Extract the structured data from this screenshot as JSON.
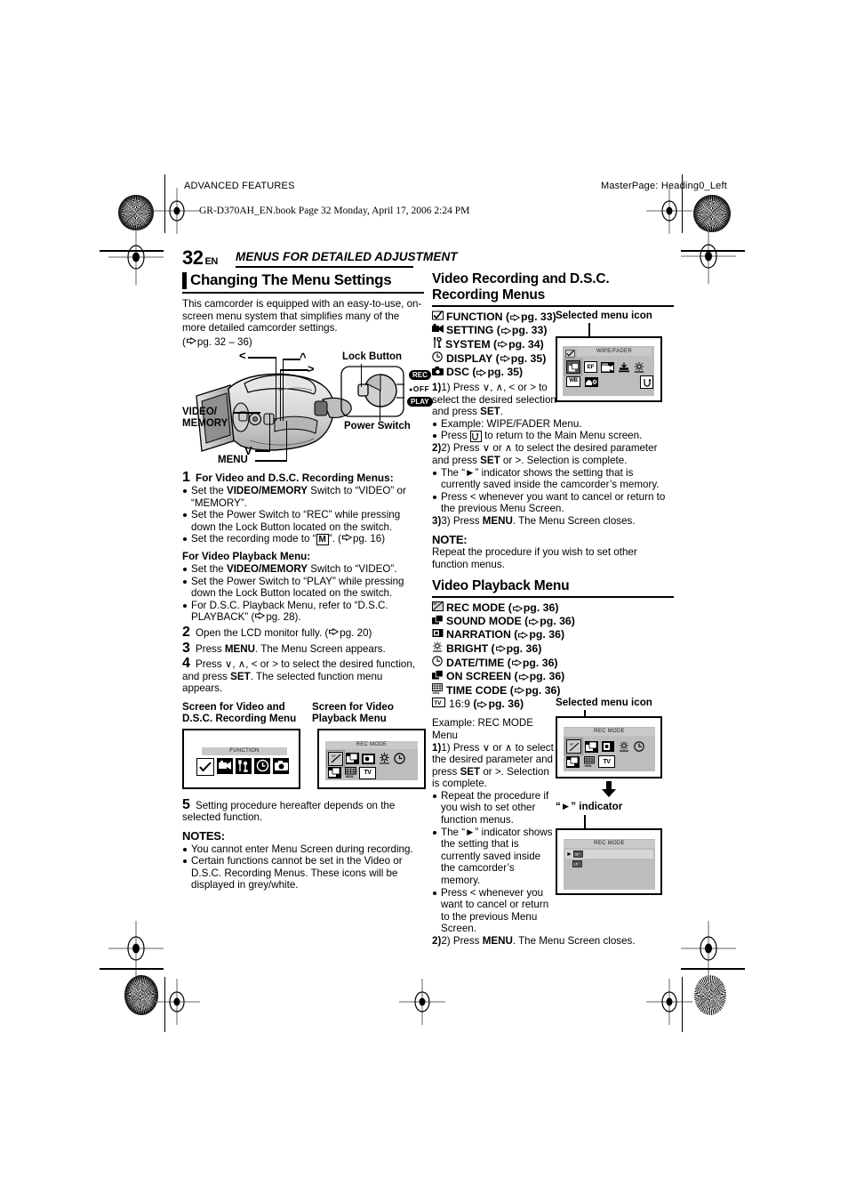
{
  "page": {
    "header_left": "ADVANCED FEATURES",
    "header_right": "MasterPage: Heading0_Left",
    "book_line": "GR-D370AH_EN.book  Page 32  Monday, April 17, 2006  2:24 PM",
    "page_number": "32",
    "page_lang": "EN",
    "running_head": "MENUS FOR DETAILED ADJUSTMENT"
  },
  "left": {
    "heading": "Changing The Menu Settings",
    "intro": "This camcorder is equipped with an easy-to-use, on-screen menu system that simplifies many of the more detailed camcorder settings.",
    "intro_ref": "pg. 32 – 36",
    "diagram": {
      "label_lock_button": "Lock Button",
      "label_power_switch": "Power Switch",
      "label_video_memory_1": "VIDEO/",
      "label_video_memory_2": "MEMORY",
      "label_menu": "MENU",
      "arrow_left": "<",
      "arrow_up": "^",
      "arrow_right": ">",
      "arrow_down": "V",
      "switch_rec": "REC",
      "switch_off": "OFF",
      "switch_play": "PLAY"
    },
    "step1": {
      "num": "1",
      "title": "For Video and D.S.C. Recording Menus:",
      "b1_pre": "Set the ",
      "b1_bold": "VIDEO/MEMORY",
      "b1_post": " Switch to “VIDEO” or “MEMORY”.",
      "b2": "Set the Power Switch to “REC” while pressing down the Lock Button located on the switch.",
      "b3_pre": "Set the recording mode to “",
      "b3_icon": "M",
      "b3_post": "”. (",
      "b3_ref": "pg. 16",
      "sub_title": "For Video Playback Menu:",
      "b4_pre": "Set the ",
      "b4_bold": "VIDEO/MEMORY",
      "b4_post": " Switch to “VIDEO”.",
      "b5": "Set the Power Switch to “PLAY” while pressing down the Lock Button located on the switch.",
      "b6": "For D.S.C. Playback Menu, refer to “D.S.C. PLAYBACK” (",
      "b6_ref": "pg. 28",
      "b6_post": ")."
    },
    "step2": {
      "num": "2",
      "text": "Open the LCD monitor fully. (",
      "ref": "pg. 20",
      "post": ")"
    },
    "step3": {
      "num": "3",
      "pre": "Press ",
      "bold": "MENU",
      "post": ". The Menu Screen appears."
    },
    "step4": {
      "num": "4",
      "pre": "Press ∨, ∧, < or > to select the desired function, and press ",
      "bold": "SET",
      "post": ". The selected function menu appears."
    },
    "caption_left_1": "Screen for Video and",
    "caption_left_2": "D.S.C. Recording Menu",
    "caption_right_1": "Screen for Video",
    "caption_right_2": "Playback Menu",
    "screen_function": {
      "title": "FUNCTION",
      "icons": [
        "check",
        "camcorder",
        "tools",
        "clock",
        "camera"
      ]
    },
    "screen_recmode": {
      "title": "REC MODE",
      "icons_row1": [
        "rec-mode",
        "sound-mode",
        "narration",
        "bright",
        "date-time"
      ],
      "icons_row2": [
        "on-screen",
        "time-code",
        "tv-16-9"
      ]
    },
    "step5": {
      "num": "5",
      "text": "Setting procedure hereafter depends on the selected function."
    },
    "notes_title": "NOTES:",
    "note1": "You cannot enter Menu Screen during recording.",
    "note2": "Certain functions cannot be set in the Video or D.S.C. Recording Menus. These icons will be displayed in grey/white."
  },
  "right": {
    "heading1": "Video Recording and D.S.C. Recording Menus",
    "menu_items": [
      {
        "icon": "function-icon",
        "label": "FUNCTION",
        "ref": "pg. 33"
      },
      {
        "icon": "setting-icon",
        "label": "SETTING",
        "ref": "pg. 33"
      },
      {
        "icon": "system-icon",
        "label": "SYSTEM",
        "ref": "pg. 34"
      },
      {
        "icon": "display-icon",
        "label": "DISPLAY",
        "ref": "pg. 35"
      },
      {
        "icon": "dsc-icon",
        "label": "DSC",
        "ref": "pg. 35"
      }
    ],
    "selected_menu_icon_label": "Selected menu icon",
    "screen_wipefader": {
      "title": "WIPE/FADER",
      "corner_icon": "function-icon",
      "icons_row1": [
        "wipe-fader",
        "effect",
        "program-ae",
        "tele-macro",
        "gain-up"
      ],
      "icons_row2": [
        "white-balance",
        "dis"
      ],
      "icons_row2_right": [
        "return"
      ]
    },
    "proc1_pre": "1) Press ∨, ∧, < or > to select the desired selection and press ",
    "proc1_bold": "SET",
    "proc1_post": ".",
    "proc1_b1": "Example: WIPE/FADER Menu.",
    "proc1_b2_pre": "Press ",
    "proc1_b2_icon": "return",
    "proc1_b2_post": " to return to the Main Menu screen.",
    "proc2_pre": "2) Press ∨ or ∧ to select the desired parameter and press ",
    "proc2_bold": "SET",
    "proc2_mid": " or >. Selection is complete.",
    "proc2_b1": "The “►” indicator shows the setting that is currently saved inside the camcorder’s memory.",
    "proc2_b2": "Press < whenever you want to cancel or return to the previous Menu Screen.",
    "proc3_pre": "3) Press ",
    "proc3_bold": "MENU",
    "proc3_post": ". The Menu Screen closes.",
    "note_title": "NOTE:",
    "note_text": "Repeat the procedure if you wish to set other function menus.",
    "heading2": "Video Playback Menu",
    "playback_items": [
      {
        "icon": "rec-mode-icon",
        "label": "REC MODE",
        "ref": "pg. 36"
      },
      {
        "icon": "sound-mode-icon",
        "label": "SOUND MODE",
        "ref": "pg. 36"
      },
      {
        "icon": "narration-icon",
        "label": "NARRATION",
        "ref": "pg. 36"
      },
      {
        "icon": "bright-icon",
        "label": "BRIGHT",
        "ref": "pg. 36"
      },
      {
        "icon": "date-time-icon",
        "label": "DATE/TIME",
        "ref": "pg. 36"
      },
      {
        "icon": "on-screen-icon",
        "label": "ON SCREEN",
        "ref": "pg. 36"
      },
      {
        "icon": "time-code-icon",
        "label": "TIME CODE",
        "ref": "pg. 36"
      },
      {
        "icon": "tv-16-9-icon",
        "label": "16:9",
        "ref": "pg. 36"
      }
    ],
    "selected_menu_icon_label2": "Selected menu icon",
    "screen_recmode2": {
      "title": "REC MODE",
      "icons_row1": [
        "rec-mode",
        "sound-mode",
        "narration",
        "bright",
        "date-time"
      ],
      "icons_row2": [
        "on-screen",
        "time-code",
        "tv-16-9"
      ]
    },
    "indicator_label": "“►” indicator",
    "screen_recmode3": {
      "title": "REC MODE",
      "row1_icon": "sp-mode",
      "row2_icon": "lp-mode"
    },
    "example_title_1": "Example: REC MODE",
    "example_title_2": "Menu",
    "ex1_pre": "1) Press ∨ or ∧ to select the desired parameter and press ",
    "ex1_bold": "SET",
    "ex1_post": " or >. Selection is complete.",
    "ex_b1": "Repeat the procedure if you wish to set other function menus.",
    "ex_b2": "The “►” indicator shows the setting that is currently saved inside the camcorder’s memory.",
    "ex_b3": "Press < whenever you want to cancel or return to the previous Menu Screen.",
    "ex2_pre": "2) Press ",
    "ex2_bold": "MENU",
    "ex2_post": ". The Menu Screen closes."
  }
}
